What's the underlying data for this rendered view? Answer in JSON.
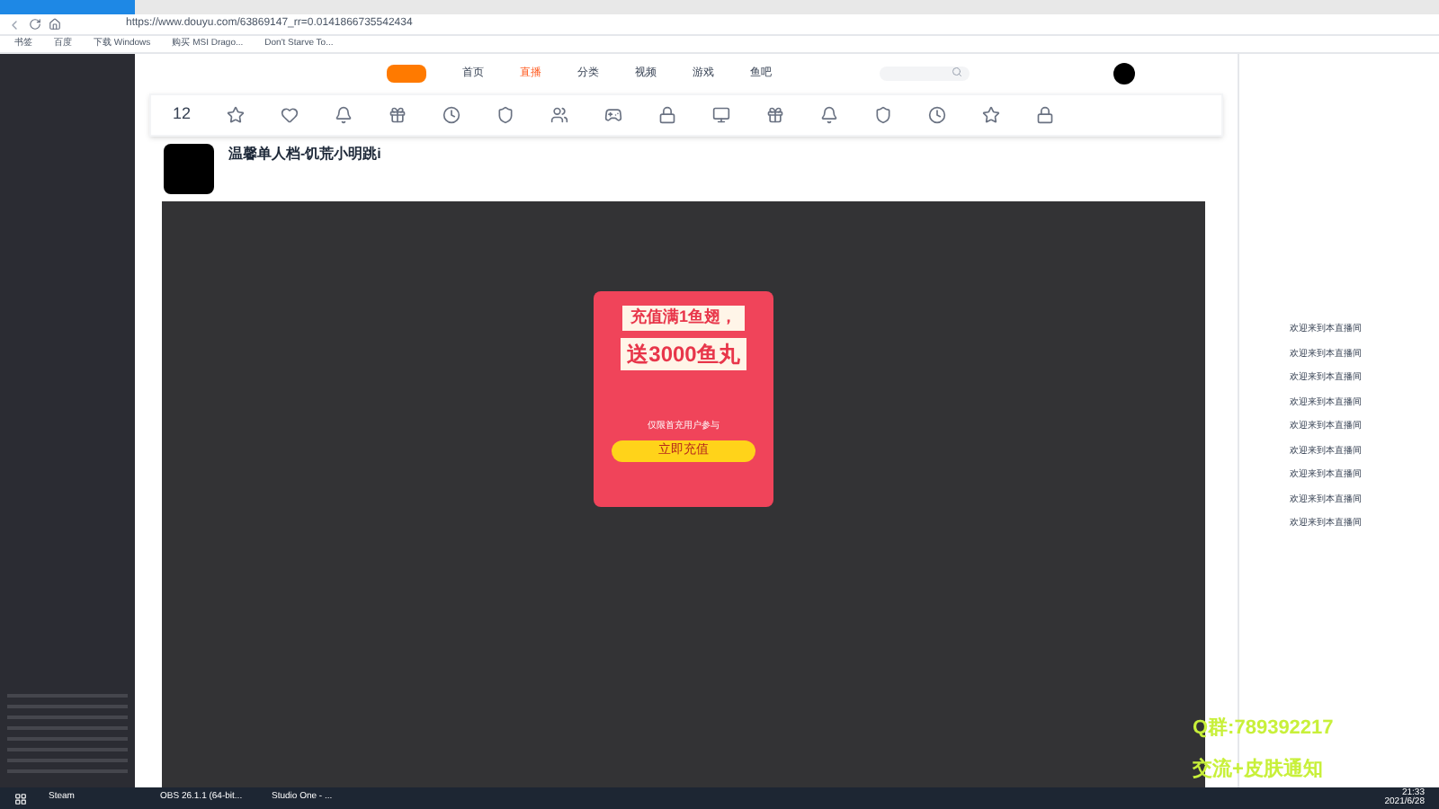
{
  "browser": {
    "url": "https://www.douyu.com/63869147_rr=0.0141866735542434",
    "bookmarks": [
      "书签",
      "百度",
      "下载 Windows",
      "购买 MSI Drago...",
      "Don't Starve To..."
    ]
  },
  "nav": [
    {
      "label": "首页",
      "selected": false
    },
    {
      "label": "直播",
      "selected": true
    },
    {
      "label": "分类",
      "selected": false
    },
    {
      "label": "视频",
      "selected": false
    },
    {
      "label": "游戏",
      "selected": false
    },
    {
      "label": "鱼吧",
      "selected": false
    }
  ],
  "toolbar": {
    "count": "12"
  },
  "room": {
    "title": "温馨单人档-饥荒小明跳i"
  },
  "promo": {
    "line1": "充值满1鱼翅，",
    "line2": "送3000鱼丸",
    "note": "仅限首充用户参与",
    "button": "立即充值"
  },
  "chat": {
    "messages": [
      "欢迎来到本直播间",
      "欢迎来到本直播间",
      "欢迎来到本直播间",
      "欢迎来到本直播间",
      "欢迎来到本直播间",
      "欢迎来到本直播间",
      "欢迎来到本直播间",
      "欢迎来到本直播间",
      "欢迎来到本直播间"
    ]
  },
  "overlay": {
    "group": "Q群:789392217",
    "notice": "交流+皮肤通知"
  },
  "taskbar": {
    "apps": [
      "Steam",
      "OBS 26.1.1 (64-bit...",
      "Studio One - ..."
    ],
    "time": "21:33",
    "date": "2021/6/28"
  }
}
